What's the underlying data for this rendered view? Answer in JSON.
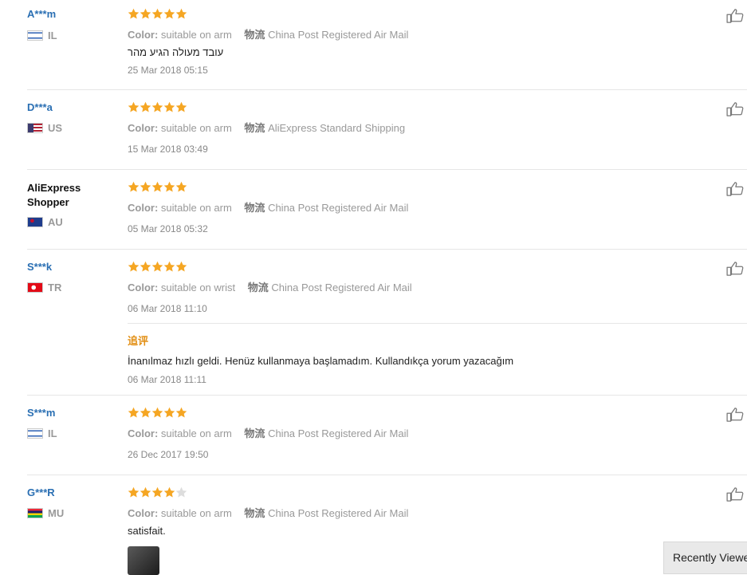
{
  "reviews": [
    {
      "user": "A***m",
      "country": "IL",
      "rating": 5,
      "attr_label": "Color:",
      "attr_value": "suitable on arm",
      "ship_label": "物流",
      "ship_value": "China Post Registered Air Mail",
      "text": "עובד מעולה הגיע מהר",
      "date": "25 Mar 2018 05:15"
    },
    {
      "user": "D***a",
      "country": "US",
      "rating": 5,
      "attr_label": "Color:",
      "attr_value": "suitable on arm",
      "ship_label": "物流",
      "ship_value": "AliExpress Standard Shipping",
      "date": "15 Mar 2018 03:49"
    },
    {
      "user": "AliExpress Shopper",
      "country": "AU",
      "rating": 5,
      "attr_label": "Color:",
      "attr_value": "suitable on arm",
      "ship_label": "物流",
      "ship_value": "China Post Registered Air Mail",
      "date": "05 Mar 2018 05:32"
    },
    {
      "user": "S***k",
      "country": "TR",
      "rating": 5,
      "attr_label": "Color:",
      "attr_value": "suitable on wrist",
      "ship_label": "物流",
      "ship_value": "China Post Registered Air Mail",
      "date": "06 Mar 2018 11:10",
      "append_label": "追评",
      "append_text": "İnanılmaz hızlı geldi. Henüz kullanmaya başlamadım. Kullandıkça yorum yazacağım",
      "append_date": "06 Mar 2018 11:11"
    },
    {
      "user": "S***m",
      "country": "IL",
      "rating": 5,
      "attr_label": "Color:",
      "attr_value": "suitable on arm",
      "ship_label": "物流",
      "ship_value": "China Post Registered Air Mail",
      "date": "26 Dec 2017 19:50"
    },
    {
      "user": "G***R",
      "country": "MU",
      "rating": 4,
      "attr_label": "Color:",
      "attr_value": "suitable on arm",
      "ship_label": "物流",
      "ship_value": "China Post Registered Air Mail",
      "text": "satisfait."
    }
  ],
  "recently_viewed": "Recently Viewed",
  "colors": {
    "star_on": "#f5a623",
    "star_off": "#dddddd",
    "user_link": "#2a6fb3",
    "append": "#e28f14"
  },
  "icons": {
    "helpful": "thumbs-up-icon",
    "star": "star-icon"
  }
}
